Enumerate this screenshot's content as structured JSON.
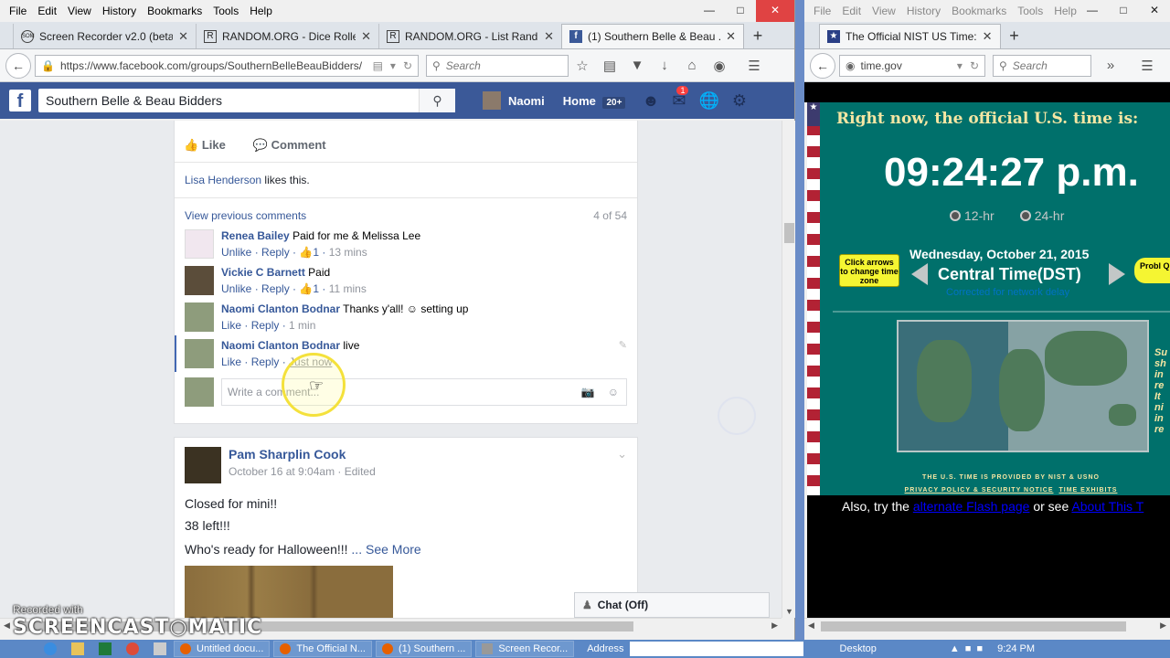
{
  "left_window": {
    "menu": [
      "File",
      "Edit",
      "View",
      "History",
      "Bookmarks",
      "Tools",
      "Help"
    ],
    "tabs": [
      {
        "label": "Screen Recorder v2.0 (beta...",
        "icon": "SOM"
      },
      {
        "label": "RANDOM.ORG - Dice Roller",
        "icon": "R"
      },
      {
        "label": "RANDOM.ORG - List Rand...",
        "icon": "R"
      },
      {
        "label": "(1) Southern Belle & Beau ...",
        "icon": "f"
      }
    ],
    "url": "https://www.facebook.com/groups/SouthernBelleBeauBidders/",
    "search_placeholder": "Search"
  },
  "facebook": {
    "search_value": "Southern Belle & Beau Bidders",
    "user_name": "Naomi",
    "home_label": "Home",
    "home_badge": "20+",
    "notif_count": "1",
    "post1": {
      "like_label": "Like",
      "comment_label": "Comment",
      "likes_user": "Lisa Henderson",
      "likes_suffix": "likes this.",
      "view_previous": "View previous comments",
      "comment_count": "4 of 54",
      "comments": [
        {
          "name": "Renea Bailey",
          "text": "Paid for me & Melissa Lee",
          "action": "Unlike",
          "reply": "Reply",
          "likes": "1",
          "time": "13 mins"
        },
        {
          "name": "Vickie C Barnett",
          "text": "Paid",
          "action": "Unlike",
          "reply": "Reply",
          "likes": "1",
          "time": "11 mins"
        },
        {
          "name": "Naomi Clanton Bodnar",
          "text": "Thanks y'all! ☺ setting up",
          "action": "Like",
          "reply": "Reply",
          "time": "1 min"
        },
        {
          "name": "Naomi Clanton Bodnar",
          "text": "live",
          "action": "Like",
          "reply": "Reply",
          "time": "Just now"
        }
      ],
      "write_placeholder": "Write a comment..."
    },
    "post2": {
      "author": "Pam Sharplin Cook",
      "meta": "October 16 at 9:04am · Edited",
      "line1": "Closed for mini!!",
      "line2": "38 left!!!",
      "line3": "Who's ready for Halloween!!!",
      "see_more": "... See More"
    },
    "chat_label": "Chat (Off)"
  },
  "right_window": {
    "menu": [
      "File",
      "Edit",
      "View",
      "History",
      "Bookmarks",
      "Tools",
      "Help"
    ],
    "tab_label": "The Official NIST US Time:",
    "url": "time.gov",
    "search_placeholder": "Search",
    "nist": {
      "title": "Right now, the official U.S. time is:",
      "time": "09:24:27 p.m.",
      "radio_12": "12-hr",
      "radio_24": "24-hr",
      "date": "Wednesday, October 21, 2015",
      "zone": "Central Time(DST)",
      "corrected": "Corrected for network delay",
      "hint": "Click arrows to change time zone",
      "prob": "Probl Quest",
      "side_text": "Su sh in re It ni in re",
      "footer1": "THE U.S. TIME IS PROVIDED BY NIST & USNO",
      "footer2a": "PRIVACY POLICY & SECURITY NOTICE",
      "footer2b": "TIME EXHIBITS",
      "also_prefix": "Also, try the",
      "also_link1": "alternate Flash page",
      "also_mid": "or see",
      "also_link2": "About This T"
    }
  },
  "taskbar": {
    "items": [
      "Untitled docu...",
      "The Official N...",
      "(1) Southern ...",
      "Screen Recor..."
    ],
    "address_label": "Address",
    "desktop_label": "Desktop",
    "clock": "9:24 PM"
  },
  "watermark": {
    "line1": "Recorded with",
    "line2": "SCREENCAST○MATIC"
  }
}
